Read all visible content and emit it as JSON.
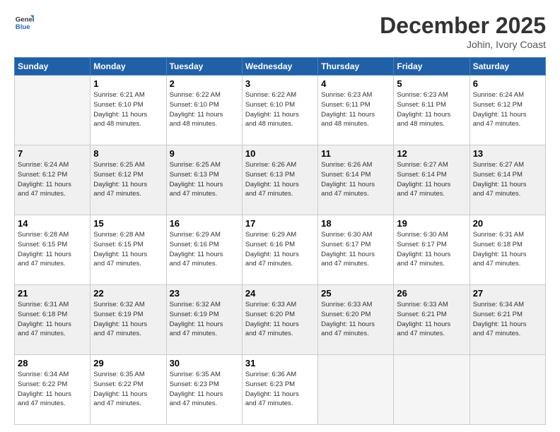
{
  "header": {
    "logo_line1": "General",
    "logo_line2": "Blue",
    "month": "December 2025",
    "location": "Johin, Ivory Coast"
  },
  "days_of_week": [
    "Sunday",
    "Monday",
    "Tuesday",
    "Wednesday",
    "Thursday",
    "Friday",
    "Saturday"
  ],
  "weeks": [
    [
      {
        "day": "",
        "info": ""
      },
      {
        "day": "1",
        "info": "Sunrise: 6:21 AM\nSunset: 6:10 PM\nDaylight: 11 hours\nand 48 minutes."
      },
      {
        "day": "2",
        "info": "Sunrise: 6:22 AM\nSunset: 6:10 PM\nDaylight: 11 hours\nand 48 minutes."
      },
      {
        "day": "3",
        "info": "Sunrise: 6:22 AM\nSunset: 6:10 PM\nDaylight: 11 hours\nand 48 minutes."
      },
      {
        "day": "4",
        "info": "Sunrise: 6:23 AM\nSunset: 6:11 PM\nDaylight: 11 hours\nand 48 minutes."
      },
      {
        "day": "5",
        "info": "Sunrise: 6:23 AM\nSunset: 6:11 PM\nDaylight: 11 hours\nand 48 minutes."
      },
      {
        "day": "6",
        "info": "Sunrise: 6:24 AM\nSunset: 6:12 PM\nDaylight: 11 hours\nand 47 minutes."
      }
    ],
    [
      {
        "day": "7",
        "info": "Sunrise: 6:24 AM\nSunset: 6:12 PM\nDaylight: 11 hours\nand 47 minutes."
      },
      {
        "day": "8",
        "info": "Sunrise: 6:25 AM\nSunset: 6:12 PM\nDaylight: 11 hours\nand 47 minutes."
      },
      {
        "day": "9",
        "info": "Sunrise: 6:25 AM\nSunset: 6:13 PM\nDaylight: 11 hours\nand 47 minutes."
      },
      {
        "day": "10",
        "info": "Sunrise: 6:26 AM\nSunset: 6:13 PM\nDaylight: 11 hours\nand 47 minutes."
      },
      {
        "day": "11",
        "info": "Sunrise: 6:26 AM\nSunset: 6:14 PM\nDaylight: 11 hours\nand 47 minutes."
      },
      {
        "day": "12",
        "info": "Sunrise: 6:27 AM\nSunset: 6:14 PM\nDaylight: 11 hours\nand 47 minutes."
      },
      {
        "day": "13",
        "info": "Sunrise: 6:27 AM\nSunset: 6:14 PM\nDaylight: 11 hours\nand 47 minutes."
      }
    ],
    [
      {
        "day": "14",
        "info": "Sunrise: 6:28 AM\nSunset: 6:15 PM\nDaylight: 11 hours\nand 47 minutes."
      },
      {
        "day": "15",
        "info": "Sunrise: 6:28 AM\nSunset: 6:15 PM\nDaylight: 11 hours\nand 47 minutes."
      },
      {
        "day": "16",
        "info": "Sunrise: 6:29 AM\nSunset: 6:16 PM\nDaylight: 11 hours\nand 47 minutes."
      },
      {
        "day": "17",
        "info": "Sunrise: 6:29 AM\nSunset: 6:16 PM\nDaylight: 11 hours\nand 47 minutes."
      },
      {
        "day": "18",
        "info": "Sunrise: 6:30 AM\nSunset: 6:17 PM\nDaylight: 11 hours\nand 47 minutes."
      },
      {
        "day": "19",
        "info": "Sunrise: 6:30 AM\nSunset: 6:17 PM\nDaylight: 11 hours\nand 47 minutes."
      },
      {
        "day": "20",
        "info": "Sunrise: 6:31 AM\nSunset: 6:18 PM\nDaylight: 11 hours\nand 47 minutes."
      }
    ],
    [
      {
        "day": "21",
        "info": "Sunrise: 6:31 AM\nSunset: 6:18 PM\nDaylight: 11 hours\nand 47 minutes."
      },
      {
        "day": "22",
        "info": "Sunrise: 6:32 AM\nSunset: 6:19 PM\nDaylight: 11 hours\nand 47 minutes."
      },
      {
        "day": "23",
        "info": "Sunrise: 6:32 AM\nSunset: 6:19 PM\nDaylight: 11 hours\nand 47 minutes."
      },
      {
        "day": "24",
        "info": "Sunrise: 6:33 AM\nSunset: 6:20 PM\nDaylight: 11 hours\nand 47 minutes."
      },
      {
        "day": "25",
        "info": "Sunrise: 6:33 AM\nSunset: 6:20 PM\nDaylight: 11 hours\nand 47 minutes."
      },
      {
        "day": "26",
        "info": "Sunrise: 6:33 AM\nSunset: 6:21 PM\nDaylight: 11 hours\nand 47 minutes."
      },
      {
        "day": "27",
        "info": "Sunrise: 6:34 AM\nSunset: 6:21 PM\nDaylight: 11 hours\nand 47 minutes."
      }
    ],
    [
      {
        "day": "28",
        "info": "Sunrise: 6:34 AM\nSunset: 6:22 PM\nDaylight: 11 hours\nand 47 minutes."
      },
      {
        "day": "29",
        "info": "Sunrise: 6:35 AM\nSunset: 6:22 PM\nDaylight: 11 hours\nand 47 minutes."
      },
      {
        "day": "30",
        "info": "Sunrise: 6:35 AM\nSunset: 6:23 PM\nDaylight: 11 hours\nand 47 minutes."
      },
      {
        "day": "31",
        "info": "Sunrise: 6:36 AM\nSunset: 6:23 PM\nDaylight: 11 hours\nand 47 minutes."
      },
      {
        "day": "",
        "info": ""
      },
      {
        "day": "",
        "info": ""
      },
      {
        "day": "",
        "info": ""
      }
    ]
  ]
}
